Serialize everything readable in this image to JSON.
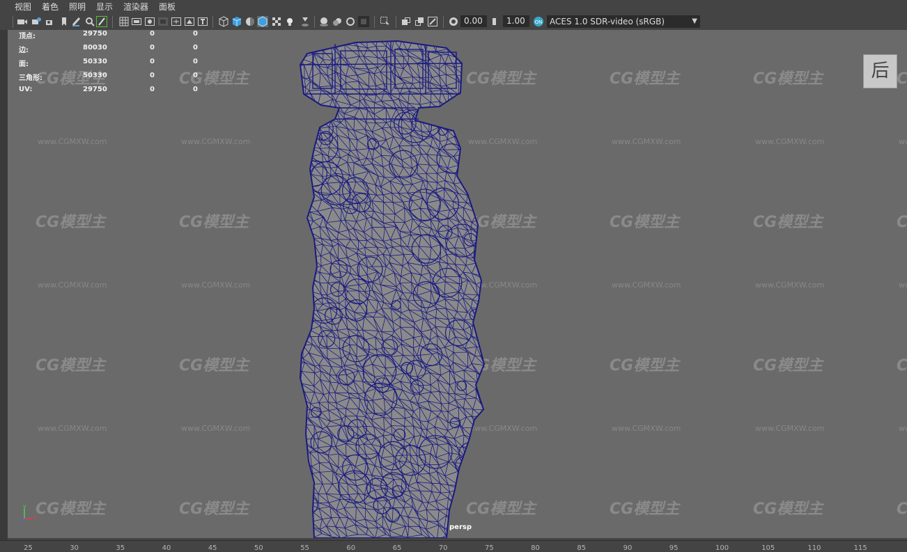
{
  "menu": [
    "视图",
    "着色",
    "照明",
    "显示",
    "渲染器",
    "面板"
  ],
  "toolbar": {
    "icons": [
      "camera-icon",
      "camera-attributes-icon",
      "bookmark-camera-icon",
      "bookmark-icon",
      "grease-pencil-icon",
      "2d-pan-zoom-icon",
      "grease-pencil-tool-icon",
      "grid-icon",
      "film-gate-icon",
      "resolution-gate-icon",
      "gate-mask-icon",
      "field-chart-icon",
      "safe-action-icon",
      "safe-title-icon",
      "wireframe-icon",
      "smooth-shade-icon",
      "default-material-icon",
      "wireframe-on-shaded-icon",
      "textured-icon",
      "use-all-lights-icon",
      "shadows-icon",
      "screen-space-ao-icon",
      "motion-blur-icon",
      "multisample-aa-icon",
      "depth-of-field-icon",
      "isolate-select-icon",
      "xray-icon",
      "xray-active-icon",
      "xray-joints-icon",
      "backface-culling-icon",
      "exposure-icon",
      "gamma-icon",
      "color-management-icon"
    ],
    "exposure": "0.00",
    "gamma": "1.00",
    "color_space": "ACES 1.0 SDR-video (sRGB)"
  },
  "hud": {
    "rows": [
      {
        "label": "顶点:",
        "value": "29750",
        "sel1": "0",
        "sel2": "0"
      },
      {
        "label": "边:",
        "value": "80030",
        "sel1": "0",
        "sel2": "0"
      },
      {
        "label": "面:",
        "value": "50330",
        "sel1": "0",
        "sel2": "0"
      },
      {
        "label": "三角形:",
        "value": "50330",
        "sel1": "0",
        "sel2": "0"
      },
      {
        "label": "UV:",
        "value": "29750",
        "sel1": "0",
        "sel2": "0"
      }
    ]
  },
  "viewcube_label": "后",
  "camera_label": "persp",
  "axis": {
    "x": "x",
    "y": "y"
  },
  "timeline_ticks": [
    "25",
    "30",
    "35",
    "40",
    "45",
    "50",
    "55",
    "60",
    "65",
    "70",
    "75",
    "80",
    "85",
    "90",
    "95",
    "100",
    "105",
    "110",
    "115"
  ],
  "watermark": {
    "logo": "CG模型主",
    "url": "www.CGMXW.com"
  },
  "colors": {
    "wire": "#1a1a80",
    "model_fill": "#8a8a8a",
    "viewport_bg": "#6a6a6a",
    "panel_bg": "#444444"
  }
}
